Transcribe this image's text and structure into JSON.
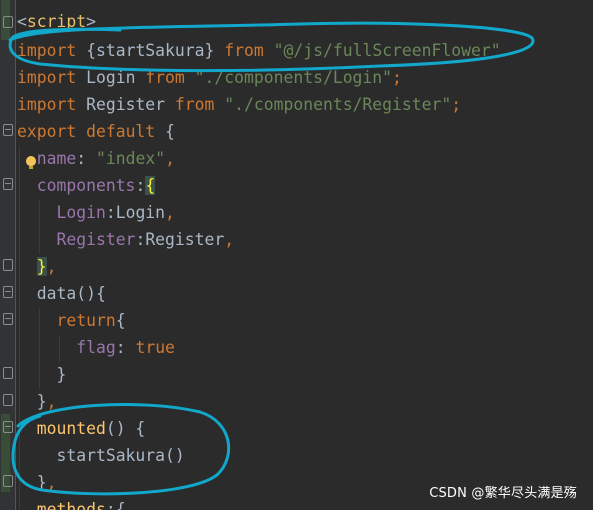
{
  "code": {
    "line1": {
      "open": "<",
      "tag": "script",
      "close": ">"
    },
    "line2": {
      "keyword": "import",
      "brace_open": "{",
      "name": "startSakura",
      "brace_close": "}",
      "from": "from",
      "path": "\"@/js/fullScreenFlower\""
    },
    "line3": {
      "keyword": "import",
      "name": "Login",
      "from": "from",
      "path": "\"./components/Login\"",
      "semicolon": ";"
    },
    "line4": {
      "keyword": "import",
      "name": "Register",
      "from": "from",
      "path": "\"./components/Register\"",
      "semicolon": ";"
    },
    "line5": {
      "keyword1": "export",
      "keyword2": "default",
      "brace": "{"
    },
    "line6": {
      "prop": "name",
      "colon": ": ",
      "value": "\"index\"",
      "comma": ","
    },
    "line7": {
      "prop": "components",
      "colon": ":",
      "brace": "{"
    },
    "line8": {
      "prop": "Login",
      "colon": ":",
      "value": "Login",
      "comma": ","
    },
    "line9": {
      "prop": "Register",
      "colon": ":",
      "value": "Register",
      "comma": ","
    },
    "line10": {
      "brace": "}",
      "comma": ","
    },
    "line11": {
      "fn": "data",
      "rest": "(){"
    },
    "line12": {
      "keyword": "return",
      "brace": "{"
    },
    "line13": {
      "prop": "flag",
      "colon": ": ",
      "value": "true"
    },
    "line14": {
      "brace": "}"
    },
    "line15": {
      "brace": "}",
      "comma": ","
    },
    "line16": {
      "fn": "mounted",
      "rest": "() {"
    },
    "line17": {
      "call": "startSakura()"
    },
    "line18": {
      "brace": "}",
      "comma": ","
    },
    "line19": {
      "fn": "methods",
      "rest": ":{"
    }
  },
  "watermark": "CSDN @繁华尽头满是殇",
  "colors": {
    "background": "#2b2b2b",
    "keyword": "#cc7832",
    "string": "#6a8759",
    "property": "#9876aa",
    "function": "#ffc66d",
    "annotation_stroke": "#11a8cc"
  }
}
